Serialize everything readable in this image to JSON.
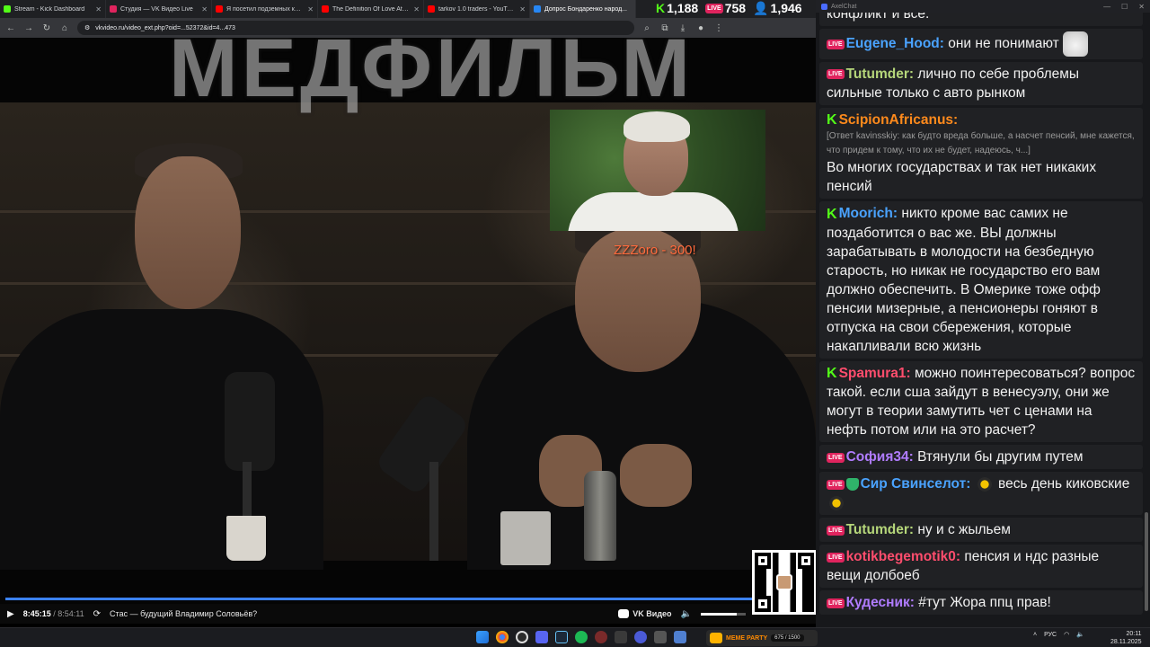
{
  "browser": {
    "tabs": [
      {
        "title": "Stream - Kick Dashboard",
        "color": "#53fc18"
      },
      {
        "title": "Студия — VK Видео Live",
        "color": "#e0245e"
      },
      {
        "title": "Я посетил подземных кротолю",
        "color": "#ff0000"
      },
      {
        "title": "The Definition Of Love At First",
        "color": "#ff0000"
      },
      {
        "title": "tarkov 1.0 traders - YouTube",
        "color": "#ff0000"
      },
      {
        "title": "Допрос Бондаренко народ...",
        "color": "#2787f5"
      }
    ],
    "url": "vkvideo.ru/video_ext.php?oid=...52372&id=4...473"
  },
  "stream_stats": {
    "kick_viewers": "1,188",
    "vk_viewers": "758",
    "total_viewers": "1,946"
  },
  "video": {
    "watermark": "МЕДФИЛЬМ",
    "donation_text": "ZZZoro - 300!",
    "progress_fraction": 0.9932,
    "time_current": "8:45:15",
    "time_separator": "/",
    "time_duration": "8:54:11",
    "title": "Стас — будущий Владимир Соловьёв?",
    "brand": "VK Видео"
  },
  "chat": {
    "window_title": "AxelChat",
    "top_fragment": "конфликт и всё.",
    "messages": [
      {
        "platform": "vk",
        "nick": "Eugene_Hood:",
        "color": "#4aa3ff",
        "text": "они не понимают",
        "emote": "cat-emote"
      },
      {
        "platform": "vk",
        "nick": "Tutumder:",
        "color": "#b5d67a",
        "text": "лично по себе проблемы сильные только с авто рынком"
      },
      {
        "platform": "kick",
        "nick": "ScipionAfricanus:",
        "color": "#ff8a1c",
        "reply": "[Ответ kavinsskiy: как будто вреда больше, а насчет пенсий, мне кажется, что придем к тому, что их не будет, надеюсь, ч...]",
        "text": "Во многих государствах и так нет никаких пенсий"
      },
      {
        "platform": "kick",
        "nick": "Moorich:",
        "color": "#4aa3ff",
        "text": "никто кроме вас самих не поздаботится о вас же. ВЫ должны зарабатывать в молодости на безбедную старость, но никак не государство его вам должно обеспечить. В Омерике тоже офф пенсии мизерные, а пенсионеры гоняют в отпуска на свои сбережения, которые накапливали всю жизнь"
      },
      {
        "platform": "kick",
        "nick": "Spamura1:",
        "color": "#ff4d6d",
        "text": "можно поинтересоваться? вопрос такой. если сша зайдут в венесуэлу, они же могут в теории замутить чет с ценами на нефть потом или на это расчет?"
      },
      {
        "platform": "vk",
        "nick": "София34:",
        "color": "#b07cff",
        "text": "Втянули бы другим путем"
      },
      {
        "platform": "vk",
        "nick": "Сир Свинселот:",
        "color": "#4aa3ff",
        "shield": true,
        "text": "весь день киковские",
        "emote": "egg-emote"
      },
      {
        "platform": "vk",
        "nick": "Tutumder:",
        "color": "#b5d67a",
        "text": "ну и с жыльем"
      },
      {
        "platform": "vk",
        "nick": "kotikbegemotik0:",
        "color": "#ff4d6d",
        "text": "пенсия и ндс разные вещи долбоеб"
      },
      {
        "platform": "vk",
        "nick": "Кудесник:",
        "color": "#b07cff",
        "text": "#тут Жора ппц прав!"
      }
    ],
    "badges": {
      "vk": "LIVE",
      "kick": "K"
    }
  },
  "taskbar": {
    "meme_label": "MEME PARTY",
    "meme_count": "675 / 1500",
    "lang": "РУС",
    "time": "20:11",
    "date": "28.11.2025"
  }
}
